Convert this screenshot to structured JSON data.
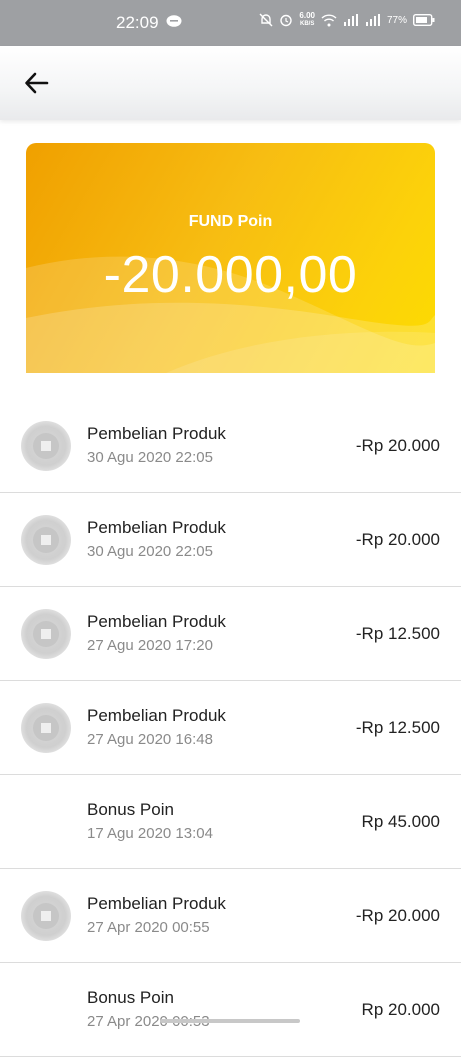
{
  "status_bar": {
    "time": "22:09",
    "net_speed_value": "6.00",
    "net_speed_unit": "KB/S",
    "battery": "77%"
  },
  "header": {
    "back_icon": "arrow-left-icon"
  },
  "balance_card": {
    "label": "FUND Poin",
    "amount": "-20.000,00"
  },
  "transactions": [
    {
      "title": "Pembelian Produk",
      "date": "30 Agu 2020 22:05",
      "amount": "-Rp 20.000",
      "has_icon": true
    },
    {
      "title": "Pembelian Produk",
      "date": "30 Agu 2020 22:05",
      "amount": "-Rp 20.000",
      "has_icon": true
    },
    {
      "title": "Pembelian Produk",
      "date": "27 Agu 2020 17:20",
      "amount": "-Rp 12.500",
      "has_icon": true
    },
    {
      "title": "Pembelian Produk",
      "date": "27 Agu 2020 16:48",
      "amount": "-Rp 12.500",
      "has_icon": true
    },
    {
      "title": "Bonus Poin",
      "date": "17 Agu 2020 13:04",
      "amount": "Rp 45.000",
      "has_icon": false
    },
    {
      "title": "Pembelian Produk",
      "date": "27 Apr 2020 00:55",
      "amount": "-Rp 20.000",
      "has_icon": true
    },
    {
      "title": "Bonus Poin",
      "date": "27 Apr 2020 00:53",
      "amount": "Rp 20.000",
      "has_icon": false
    }
  ]
}
